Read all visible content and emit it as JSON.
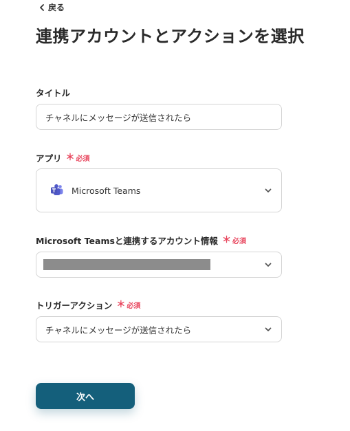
{
  "nav": {
    "back_label": "戻る"
  },
  "page_title": "連携アカウントとアクションを選択",
  "required_label": "必須",
  "fields": {
    "title": {
      "label": "タイトル",
      "value": "チャネルにメッセージが送信されたら"
    },
    "app": {
      "label": "アプリ",
      "value": "Microsoft Teams",
      "icon": "microsoft-teams-icon"
    },
    "account": {
      "label": "Microsoft Teamsと連携するアカウント情報"
    },
    "trigger": {
      "label": "トリガーアクション",
      "value": "チャネルにメッセージが送信されたら"
    }
  },
  "next_button_label": "次へ",
  "colors": {
    "primary": "#145f7b",
    "required": "#e8455d",
    "border": "#d4d4d4",
    "masked": "#8c8c8c",
    "teams_purple": "#5059c9"
  }
}
